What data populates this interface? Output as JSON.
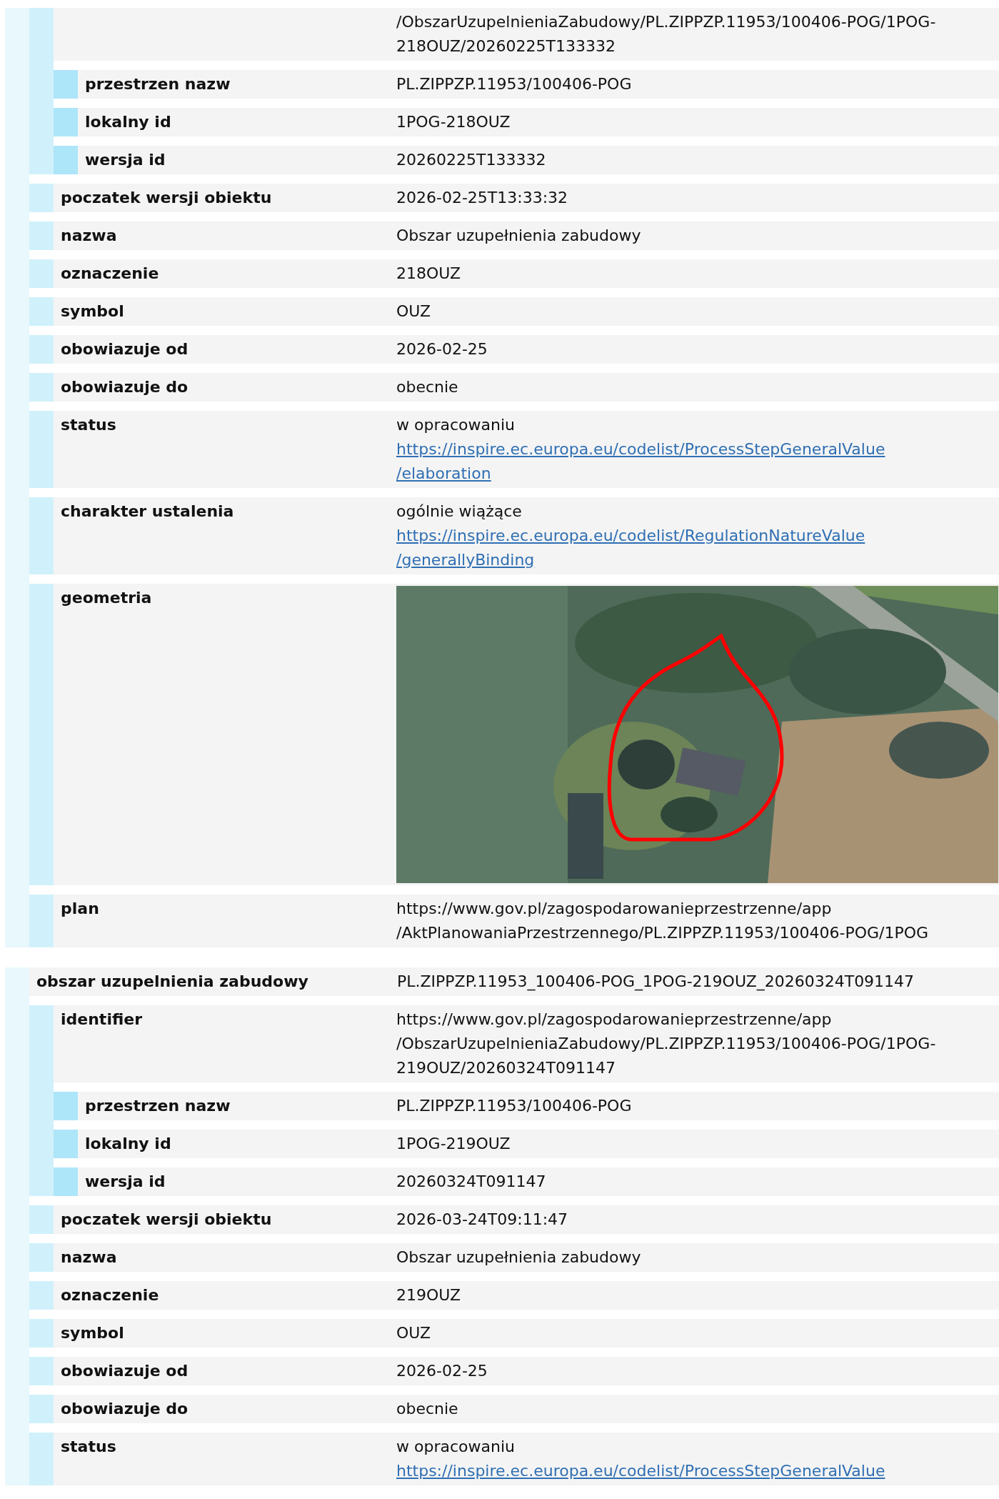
{
  "features": [
    {
      "properties": [
        {
          "lines": [
            "/ObszarUzupelnieniaZabudowy/PL.ZIPPZP.11953/100406-POG/1POG-",
            "218OUZ/20260225T133332"
          ],
          "children": [
            {
              "label": "przestrzen nazw",
              "lines": [
                "PL.ZIPPZP.11953/100406-POG"
              ]
            },
            {
              "label": "lokalny id",
              "lines": [
                "1POG-218OUZ"
              ]
            },
            {
              "label": "wersja id",
              "lines": [
                "20260225T133332"
              ]
            }
          ]
        },
        {
          "label": "poczatek wersji obiektu",
          "lines": [
            "2026-02-25T13:33:32"
          ]
        },
        {
          "label": "nazwa",
          "lines": [
            "Obszar uzupełnienia zabudowy"
          ]
        },
        {
          "label": "oznaczenie",
          "lines": [
            "218OUZ"
          ]
        },
        {
          "label": "symbol",
          "lines": [
            "OUZ"
          ]
        },
        {
          "label": "obowiazuje od",
          "lines": [
            "2026-02-25"
          ]
        },
        {
          "label": "obowiazuje do",
          "lines": [
            "obecnie"
          ]
        },
        {
          "label": "status",
          "lines": [
            "w opracowaniu"
          ],
          "link_lines": [
            "https://inspire.ec.europa.eu/codelist/ProcessStepGeneralValue",
            "/elaboration"
          ]
        },
        {
          "label": "charakter ustalenia",
          "lines": [
            "ogólnie wiążące"
          ],
          "link_lines": [
            "https://inspire.ec.europa.eu/codelist/RegulationNatureValue",
            "/generallyBinding"
          ]
        },
        {
          "label": "geometria",
          "kind": "picture"
        },
        {
          "label": "plan",
          "lines": [
            "https://www.gov.pl/zagospodarowanieprzestrzenne/app",
            "/AktPlanowaniaPrzestrzennego/PL.ZIPPZP.11953/100406-POG/1POG"
          ]
        }
      ]
    },
    {
      "header": {
        "label": "obszar uzupelnienia zabudowy",
        "lines": [
          "PL.ZIPPZP.11953_100406-POG_1POG-219OUZ_20260324T091147"
        ]
      },
      "properties": [
        {
          "label": "identifier",
          "lines": [
            "https://www.gov.pl/zagospodarowanieprzestrzenne/app",
            "/ObszarUzupelnieniaZabudowy/PL.ZIPPZP.11953/100406-POG/1POG-",
            "219OUZ/20260324T091147"
          ],
          "children": [
            {
              "label": "przestrzen nazw",
              "lines": [
                "PL.ZIPPZP.11953/100406-POG"
              ]
            },
            {
              "label": "lokalny id",
              "lines": [
                "1POG-219OUZ"
              ]
            },
            {
              "label": "wersja id",
              "lines": [
                "20260324T091147"
              ]
            }
          ]
        },
        {
          "label": "poczatek wersji obiektu",
          "lines": [
            "2026-03-24T09:11:47"
          ]
        },
        {
          "label": "nazwa",
          "lines": [
            "Obszar uzupełnienia zabudowy"
          ]
        },
        {
          "label": "oznaczenie",
          "lines": [
            "219OUZ"
          ]
        },
        {
          "label": "symbol",
          "lines": [
            "OUZ"
          ]
        },
        {
          "label": "obowiazuje od",
          "lines": [
            "2026-02-25"
          ]
        },
        {
          "label": "obowiazuje do",
          "lines": [
            "obecnie"
          ]
        },
        {
          "label": "status",
          "lines": [
            "w opracowaniu"
          ],
          "link_lines": [
            "https://inspire.ec.europa.eu/codelist/ProcessStepGeneralValue"
          ]
        }
      ]
    }
  ]
}
